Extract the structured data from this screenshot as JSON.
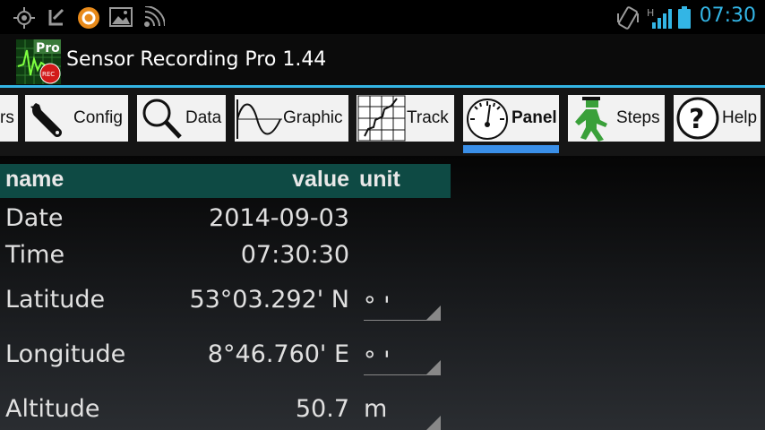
{
  "status_bar": {
    "time": "07:30",
    "icons": [
      "gps-icon",
      "missed-call-icon",
      "avast-icon",
      "image-icon",
      "wireless-icon",
      "vibrate-icon",
      "signal-icon",
      "battery-icon"
    ],
    "accent_color": "#33b5e5"
  },
  "action_bar": {
    "title": "Sensor Recording Pro 1.44",
    "icon_badge": "Pro",
    "icon_rec": "REC"
  },
  "tabs": [
    {
      "label": "rs",
      "icon": "none"
    },
    {
      "label": "Config",
      "icon": "wrench-icon"
    },
    {
      "label": "Data",
      "icon": "magnifier-icon"
    },
    {
      "label": "Graphic",
      "icon": "sine-wave-icon"
    },
    {
      "label": "Track",
      "icon": "track-map-icon"
    },
    {
      "label": "Panel",
      "icon": "gauge-icon",
      "selected": true
    },
    {
      "label": "Steps",
      "icon": "walking-man-icon"
    },
    {
      "label": "Help",
      "icon": "question-icon"
    }
  ],
  "table": {
    "headers": {
      "name": "name",
      "value": "value",
      "unit": "unit"
    },
    "rows": [
      {
        "name": "Date",
        "value": "2014-09-03",
        "unit": ""
      },
      {
        "name": "Time",
        "value": "07:30:30",
        "unit": ""
      },
      {
        "name": "Latitude",
        "value": "53°03.292' N",
        "unit": "° '"
      },
      {
        "name": "Longitude",
        "value": "8°46.760' E",
        "unit": "° '"
      },
      {
        "name": "Altitude",
        "value": "50.7",
        "unit": "m"
      }
    ]
  }
}
